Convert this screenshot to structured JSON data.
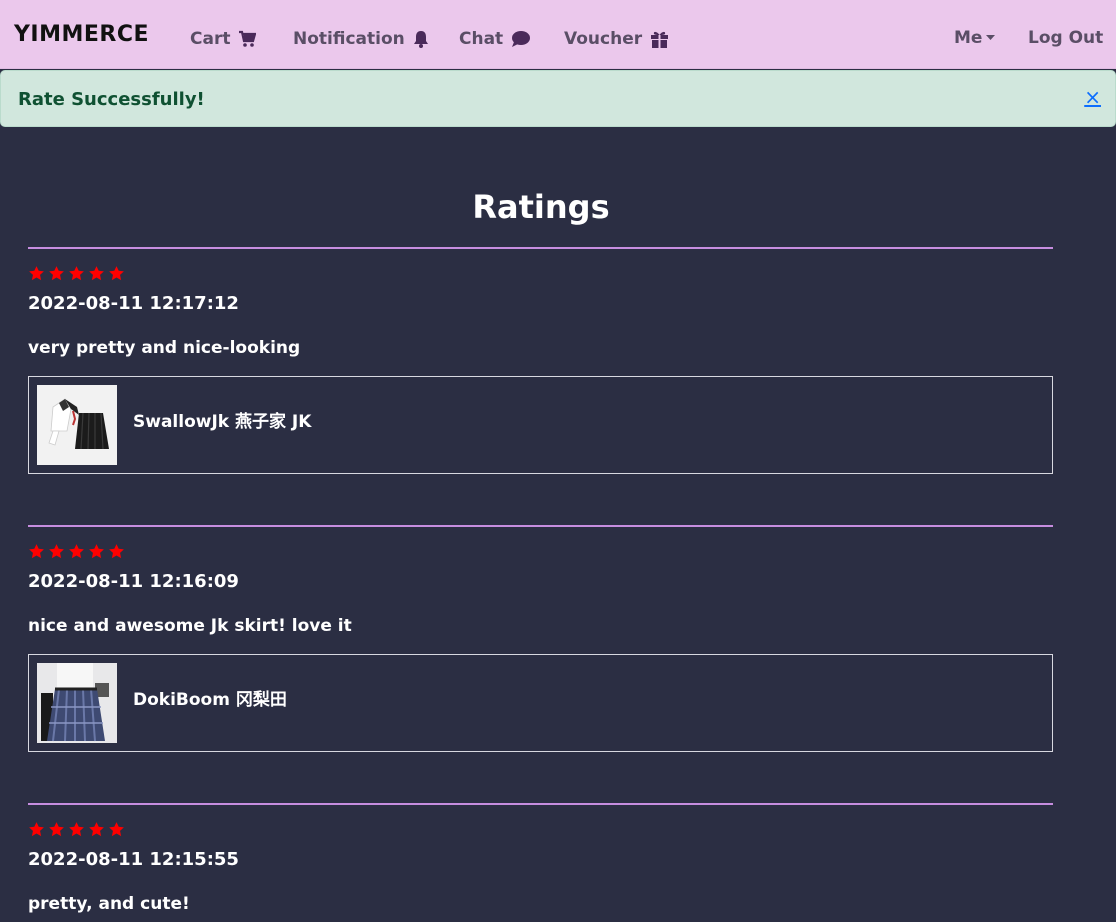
{
  "navbar": {
    "brand": "YIMMERCE",
    "items": [
      {
        "label": "Cart",
        "icon": "cart-icon"
      },
      {
        "label": "Notification",
        "icon": "bell-icon"
      },
      {
        "label": "Chat",
        "icon": "chat-bubble-icon"
      },
      {
        "label": "Voucher",
        "icon": "gift-icon"
      }
    ],
    "me_label": "Me",
    "logout_label": "Log Out"
  },
  "alert": {
    "message": "Rate Successfully!",
    "close_symbol": "×"
  },
  "page": {
    "title": "Ratings"
  },
  "colors": {
    "navbar_bg": "#ebc8ec",
    "page_bg": "#2b2e43",
    "divider": "#c68de0",
    "star": "#ff0000",
    "alert_bg": "#d1e7dd",
    "alert_text": "#0f5132"
  },
  "ratings": [
    {
      "stars": 5,
      "date": "2022-08-11 12:17:12",
      "comment": "very pretty and nice-looking",
      "product": {
        "name": "SwallowJk 燕子家 JK",
        "thumb": "sailor-uniform-image"
      }
    },
    {
      "stars": 5,
      "date": "2022-08-11 12:16:09",
      "comment": "nice and awesome Jk skirt! love it",
      "product": {
        "name": "DokiBoom 冈梨田",
        "thumb": "plaid-skirt-image"
      }
    },
    {
      "stars": 5,
      "date": "2022-08-11 12:15:55",
      "comment": "pretty, and cute!"
    }
  ]
}
